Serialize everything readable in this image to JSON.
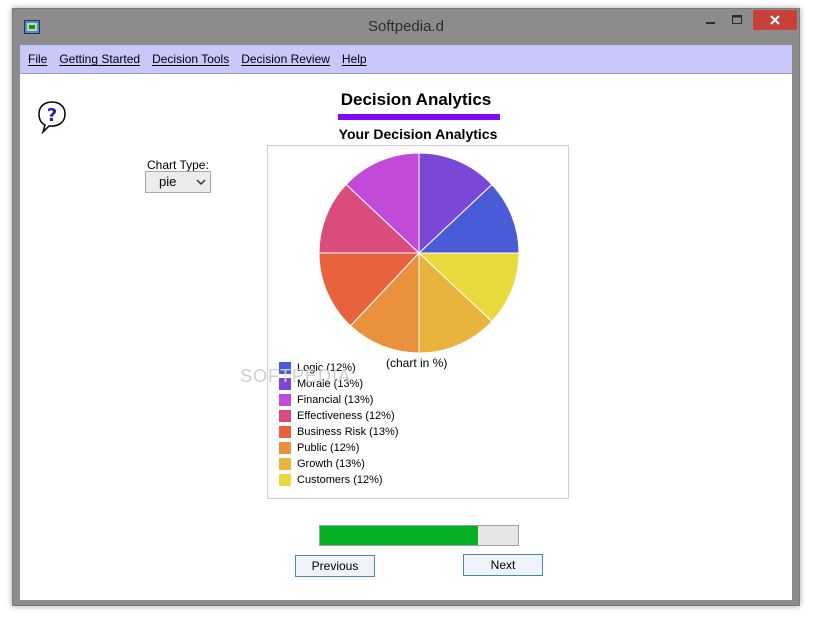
{
  "window": {
    "title": "Softpedia.d"
  },
  "menu": {
    "items": [
      {
        "label": "File"
      },
      {
        "label": "Getting Started"
      },
      {
        "label": "Decision Tools"
      },
      {
        "label": "Decision Review"
      },
      {
        "label": "Help"
      }
    ]
  },
  "page": {
    "title": "Decision Analytics",
    "accent_color": "#7f0af5",
    "chart_type_label": "Chart Type:",
    "chart_type_value": "pie",
    "watermark": "SOFTPEDIA"
  },
  "chart_data": {
    "type": "pie",
    "title": "Your Decision Analytics",
    "note": "(chart in %)",
    "legend_position": "bottom-left",
    "slices": [
      {
        "name": "Logic",
        "label": "Logic (12%)",
        "value": 12,
        "color": "#4a5bd8"
      },
      {
        "name": "Morale",
        "label": "Morale (13%)",
        "value": 13,
        "color": "#7a47d6"
      },
      {
        "name": "Financial",
        "label": "Financial (13%)",
        "value": 13,
        "color": "#c14ad8"
      },
      {
        "name": "Effectiveness",
        "label": "Effectiveness (12%)",
        "value": 12,
        "color": "#d94c7b"
      },
      {
        "name": "Business Risk",
        "label": "Business Risk (13%)",
        "value": 13,
        "color": "#e8623d"
      },
      {
        "name": "Public",
        "label": "Public (12%)",
        "value": 12,
        "color": "#ea913d"
      },
      {
        "name": "Growth",
        "label": "Growth (13%)",
        "value": 13,
        "color": "#e9b43d"
      },
      {
        "name": "Customers",
        "label": "Customers (12%)",
        "value": 12,
        "color": "#e8d93d"
      }
    ]
  },
  "progress": {
    "value": 0.8,
    "color": "#06b025"
  },
  "nav": {
    "previous_label": "Previous",
    "next_label": "Next"
  }
}
